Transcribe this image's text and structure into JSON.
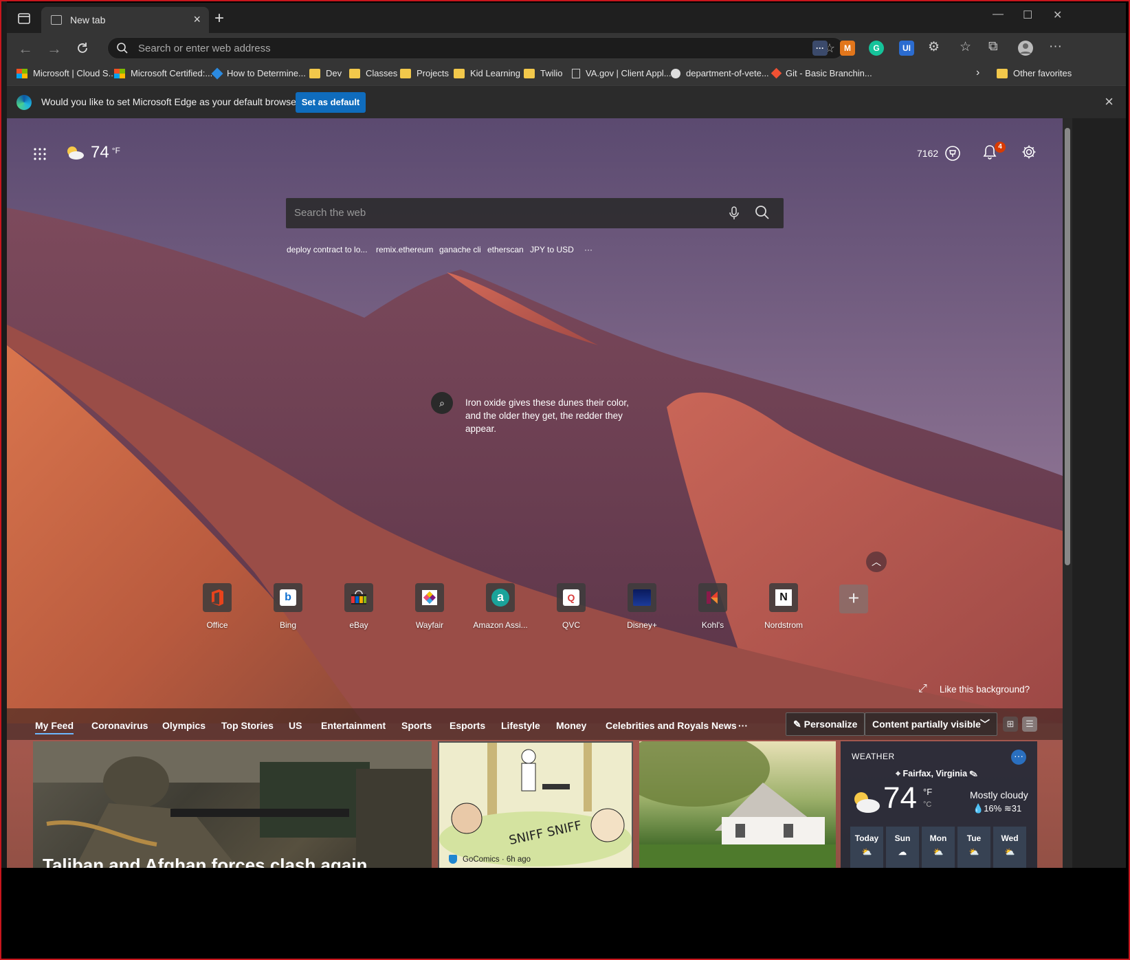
{
  "browser": {
    "tab_title": "New tab",
    "address_placeholder": "Search or enter web address",
    "window_controls": {
      "minimize": "—",
      "maximize": "☐",
      "close": "✕"
    }
  },
  "bookmarks": [
    {
      "label": "Microsoft | Cloud S...",
      "icon": "microsoft-logo-icon"
    },
    {
      "label": "Microsoft Certified:...",
      "icon": "microsoft-logo-icon"
    },
    {
      "label": "How to Determine...",
      "icon": "azure-devops-icon"
    },
    {
      "label": "Dev",
      "icon": "folder-icon"
    },
    {
      "label": "Classes",
      "icon": "folder-icon"
    },
    {
      "label": "Projects",
      "icon": "folder-icon"
    },
    {
      "label": "Kid Learning",
      "icon": "folder-icon"
    },
    {
      "label": "Twilio",
      "icon": "folder-icon"
    },
    {
      "label": "VA.gov | Client Appl...",
      "icon": "page-icon"
    },
    {
      "label": "department-of-vete...",
      "icon": "github-icon"
    },
    {
      "label": "Git - Basic Branchin...",
      "icon": "git-icon"
    }
  ],
  "other_favorites": "Other favorites",
  "infobar": {
    "message": "Would you like to set Microsoft Edge as your default browser?",
    "button": "Set as default"
  },
  "newtab": {
    "weather_temp": "74",
    "weather_unit": "°F",
    "rewards_points": "7162",
    "notification_count": "4",
    "search_placeholder": "Search the web",
    "suggestions": [
      "deploy contract to lo...",
      "remix.ethereum",
      "ganache cli",
      "etherscan",
      "JPY to USD"
    ],
    "suggestions_more": "···",
    "image_caption": "Iron oxide gives these dunes their color, and the older they get, the redder they appear.",
    "like_background": "Like this background?",
    "quick_links": [
      {
        "label": "Office",
        "icon": "office-icon"
      },
      {
        "label": "Bing",
        "icon": "bing-icon"
      },
      {
        "label": "eBay",
        "icon": "ebay-icon"
      },
      {
        "label": "Wayfair",
        "icon": "wayfair-icon"
      },
      {
        "label": "Amazon Assi...",
        "icon": "amazon-icon"
      },
      {
        "label": "QVC",
        "icon": "qvc-icon"
      },
      {
        "label": "Disney+",
        "icon": "disney-icon"
      },
      {
        "label": "Kohl's",
        "icon": "kohls-icon"
      },
      {
        "label": "Nordstrom",
        "icon": "nordstrom-icon"
      }
    ]
  },
  "feed": {
    "tabs": [
      "My Feed",
      "Coronavirus",
      "Olympics",
      "Top Stories",
      "US",
      "Entertainment",
      "Sports",
      "Esports",
      "Lifestyle",
      "Money",
      "Celebrities and Royals News"
    ],
    "more": "···",
    "personalize": "Personalize",
    "visibility": "Content partially visible",
    "cards": {
      "headline": "Taliban and Afghan forces clash again",
      "comic_text": "SNIFF SNIFF",
      "comic_source": "GoComics · 6h ago"
    },
    "weather": {
      "title": "WEATHER",
      "location": "Fairfax, Virginia",
      "temp": "74",
      "unit_f": "°F",
      "unit_c": "°C",
      "condition": "Mostly cloudy",
      "precip": "16%",
      "wind": "31",
      "days": [
        "Today",
        "Sun",
        "Mon",
        "Tue",
        "Wed"
      ]
    }
  }
}
